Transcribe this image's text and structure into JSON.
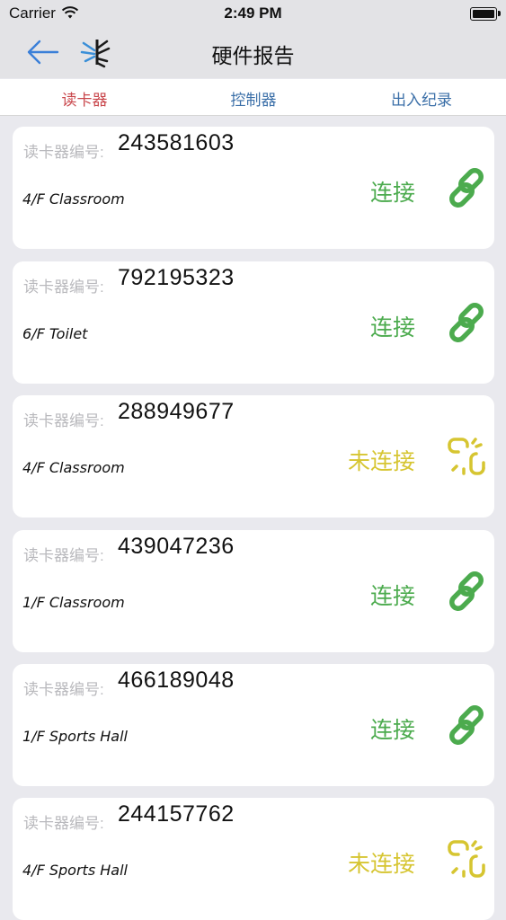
{
  "status_bar": {
    "carrier": "Carrier",
    "time": "2:49 PM"
  },
  "nav": {
    "title": "硬件报告"
  },
  "tabs": [
    {
      "label": "读卡器",
      "active": true
    },
    {
      "label": "控制器",
      "active": false
    },
    {
      "label": "出入纪录",
      "active": false
    }
  ],
  "colors": {
    "connected": "#4cab4e",
    "disconnected": "#d6c531",
    "active_tab": "#c9474c",
    "tab": "#3b6fa8",
    "back_arrow": "#3a7fd8"
  },
  "readers": [
    {
      "id_label": "读卡器编号:",
      "id": "243581603",
      "location": "4/F Classroom",
      "status": "连接",
      "connected": true,
      "icon": "link-icon"
    },
    {
      "id_label": "读卡器编号:",
      "id": "792195323",
      "location": "6/F Toilet",
      "status": "连接",
      "connected": true,
      "icon": "link-icon"
    },
    {
      "id_label": "读卡器编号:",
      "id": "288949677",
      "location": "4/F Classroom",
      "status": "未连接",
      "connected": false,
      "icon": "broken-link-icon"
    },
    {
      "id_label": "读卡器编号:",
      "id": "439047236",
      "location": "1/F Classroom",
      "status": "连接",
      "connected": true,
      "icon": "link-icon"
    },
    {
      "id_label": "读卡器编号:",
      "id": "466189048",
      "location": "1/F Sports Hall",
      "status": "连接",
      "connected": true,
      "icon": "link-icon"
    },
    {
      "id_label": "读卡器编号:",
      "id": "244157762",
      "location": "4/F Sports Hall",
      "status": "未连接",
      "connected": false,
      "icon": "broken-link-icon"
    }
  ]
}
